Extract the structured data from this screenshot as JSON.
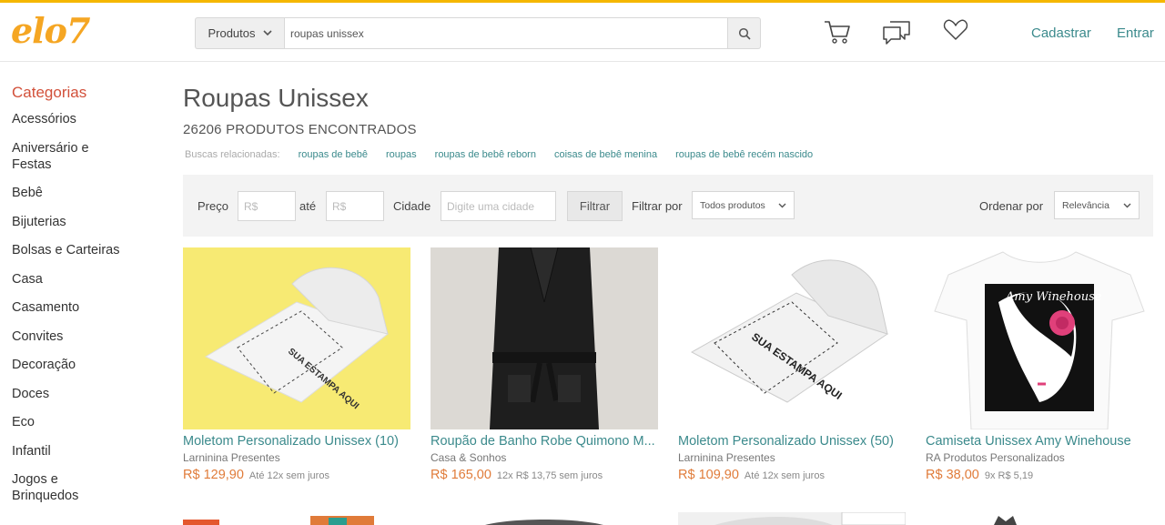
{
  "header": {
    "logo": "elo7",
    "search_category": "Produtos",
    "search_value": "roupas unissex",
    "register": "Cadastrar",
    "login": "Entrar",
    "icons": [
      "cart-icon",
      "chat-icon",
      "heart-icon",
      "search-icon"
    ]
  },
  "sidebar": {
    "title": "Categorias",
    "items": [
      "Acessórios",
      "Aniversário e Festas",
      "Bebê",
      "Bijuterias",
      "Bolsas e Carteiras",
      "Casa",
      "Casamento",
      "Convites",
      "Decoração",
      "Doces",
      "Eco",
      "Infantil",
      "Jogos e Brinquedos"
    ]
  },
  "main": {
    "title": "Roupas Unissex",
    "count": "26206 PRODUTOS ENCONTRADOS",
    "related_label": "Buscas relacionadas:",
    "related": [
      "roupas de bebê",
      "roupas",
      "roupas de bebê reborn",
      "coisas de bebê menina",
      "roupas de bebê recém nascido"
    ]
  },
  "filters": {
    "price_label": "Preço",
    "price_min_placeholder": "R$",
    "to_label": "até",
    "price_max_placeholder": "R$",
    "city_label": "Cidade",
    "city_placeholder": "Digite uma cidade",
    "filter_button": "Filtrar",
    "filter_by_label": "Filtrar por",
    "filter_by_value": "Todos produtos",
    "sort_label": "Ordenar por",
    "sort_value": "Relevância"
  },
  "products": [
    {
      "title": "Moletom Personalizado Unissex (10)",
      "shop": "Larninina Presentes",
      "price": "R$ 129,90",
      "installments": "Até 12x sem juros",
      "stamp": "SUA ESTAMPA AQUI"
    },
    {
      "title": "Roupão de Banho Robe Quimono M...",
      "shop": "Casa & Sonhos",
      "price": "R$ 165,00",
      "installments": "12x R$ 13,75 sem juros"
    },
    {
      "title": "Moletom Personalizado Unissex (50)",
      "shop": "Larninina Presentes",
      "price": "R$ 109,90",
      "installments": "Até 12x sem juros",
      "stamp": "SUA ESTAMPA AQUI"
    },
    {
      "title": "Camiseta Unissex Amy Winehouse",
      "shop": "RA Produtos Personalizados",
      "price": "R$ 38,00",
      "installments": "9x R$ 5,19",
      "print_text": "Amy Winehouse"
    }
  ],
  "colors": {
    "accent": "#3b8a8c",
    "price": "#e07b39",
    "category_title": "#d2503a",
    "logo": "#f5a623",
    "top_border": "#f5b700"
  }
}
